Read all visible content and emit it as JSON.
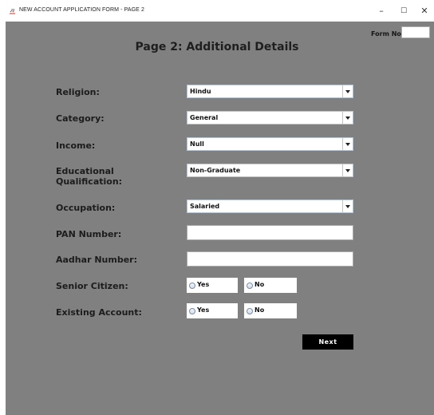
{
  "window": {
    "title": "NEW ACCOUNT APPLICATION FORM - PAGE 2",
    "minimize": "–",
    "maximize": "☐",
    "close": "✕"
  },
  "form": {
    "heading": "Page 2: Additional Details",
    "form_no_label": "Form No:",
    "form_no_value": "",
    "religion": {
      "label": "Religion:",
      "value": "Hindu"
    },
    "category": {
      "label": "Category:",
      "value": "General"
    },
    "income": {
      "label": "Income:",
      "value": "Null"
    },
    "education": {
      "label_line1": "Educational",
      "label_line2": "Qualification:",
      "value": "Non-Graduate"
    },
    "occupation": {
      "label": "Occupation:",
      "value": "Salaried"
    },
    "pan": {
      "label": "PAN Number:",
      "value": ""
    },
    "aadhar": {
      "label": "Aadhar Number:",
      "value": ""
    },
    "senior_citizen": {
      "label": "Senior Citizen:",
      "yes": "Yes",
      "no": "No"
    },
    "existing_account": {
      "label": "Existing Account:",
      "yes": "Yes",
      "no": "No"
    },
    "next_button": "Next"
  }
}
